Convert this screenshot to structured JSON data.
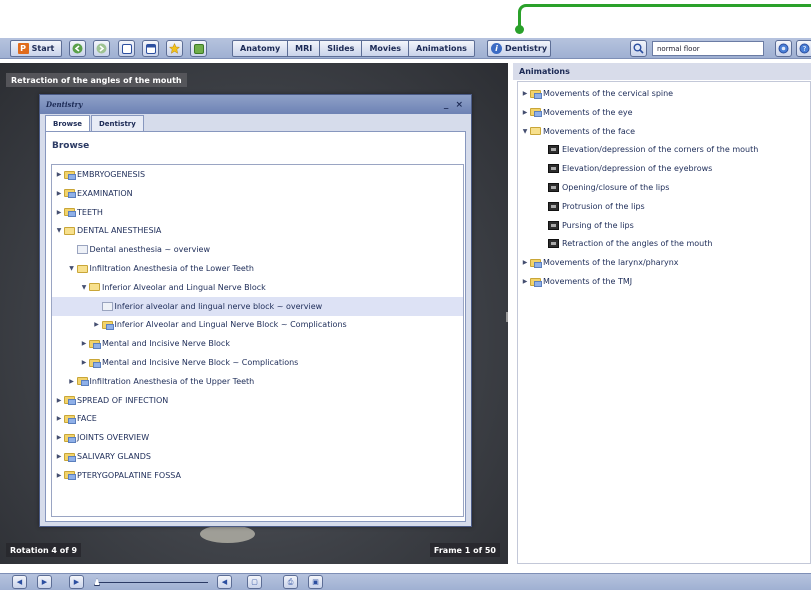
{
  "colors": {
    "accent_green": "#2aa12a",
    "toolbar_bg": "#b6c3de",
    "selection": "#dde2f5"
  },
  "toolbar": {
    "start_label": "Start",
    "tabs": [
      "Anatomy",
      "MRI",
      "Slides",
      "Movies",
      "Animations"
    ],
    "dentistry_label": "Dentistry",
    "search_value": "normal floor",
    "icons": [
      "back-icon",
      "forward-icon",
      "window-icon",
      "layout-icon",
      "favorites-icon",
      "image-icon",
      "search-icon",
      "globe-icon",
      "help-icon"
    ]
  },
  "viewer": {
    "title": "Retraction of the angles of the mouth",
    "rotation": "Rotation 4 of 9",
    "frame": "Frame 1 of 50"
  },
  "dentistry_window": {
    "title": "Dentistry",
    "controls": "_ ×",
    "tabs": [
      "Browse",
      "Dentistry"
    ],
    "heading": "Browse",
    "tree": [
      {
        "label": "EMBRYOGENESIS",
        "level": 0,
        "type": "folder",
        "state": "closed"
      },
      {
        "label": "EXAMINATION",
        "level": 0,
        "type": "folder",
        "state": "closed"
      },
      {
        "label": "TEETH",
        "level": 0,
        "type": "folder",
        "state": "closed"
      },
      {
        "label": "DENTAL ANESTHESIA",
        "level": 0,
        "type": "folder",
        "state": "open"
      },
      {
        "label": "Dental anesthesia ~ overview",
        "level": 1,
        "type": "doc"
      },
      {
        "label": "Infiltration Anesthesia of the Lower Teeth",
        "level": 1,
        "type": "folder",
        "state": "open"
      },
      {
        "label": "Inferior Alveolar and Lingual Nerve Block",
        "level": 2,
        "type": "folder",
        "state": "open"
      },
      {
        "label": "Inferior alveolar and lingual nerve block ~ overview",
        "level": 3,
        "type": "doc",
        "selected": true
      },
      {
        "label": "Inferior Alveolar and Lingual Nerve Block ~ Complications",
        "level": 3,
        "type": "folder",
        "state": "closed"
      },
      {
        "label": "Mental and Incisive Nerve Block",
        "level": 2,
        "type": "folder",
        "state": "closed"
      },
      {
        "label": "Mental and Incisive Nerve Block ~ Complications",
        "level": 2,
        "type": "folder",
        "state": "closed"
      },
      {
        "label": "Infiltration Anesthesia of the Upper Teeth",
        "level": 1,
        "type": "folder",
        "state": "closed"
      },
      {
        "label": "SPREAD OF INFECTION",
        "level": 0,
        "type": "folder",
        "state": "closed"
      },
      {
        "label": "FACE",
        "level": 0,
        "type": "folder",
        "state": "closed"
      },
      {
        "label": "JOINTS OVERVIEW",
        "level": 0,
        "type": "folder",
        "state": "closed"
      },
      {
        "label": "SALIVARY GLANDS",
        "level": 0,
        "type": "folder",
        "state": "closed"
      },
      {
        "label": "PTERYGOPALATINE FOSSA",
        "level": 0,
        "type": "folder",
        "state": "closed"
      }
    ]
  },
  "animations": {
    "header": "Animations",
    "tree": [
      {
        "label": "Movements of the cervical spine",
        "level": 0,
        "type": "folder",
        "state": "closed"
      },
      {
        "label": "Movements of the eye",
        "level": 0,
        "type": "folder",
        "state": "closed"
      },
      {
        "label": "Movements of the face",
        "level": 0,
        "type": "folder",
        "state": "open"
      },
      {
        "label": "Elevation/depression of the corners of the mouth",
        "level": 1,
        "type": "film"
      },
      {
        "label": "Elevation/depression of the eyebrows",
        "level": 1,
        "type": "film"
      },
      {
        "label": "Opening/closure of the lips",
        "level": 1,
        "type": "film"
      },
      {
        "label": "Protrusion of the lips",
        "level": 1,
        "type": "film"
      },
      {
        "label": "Pursing of the lips",
        "level": 1,
        "type": "film"
      },
      {
        "label": "Retraction of the angles of the mouth",
        "level": 1,
        "type": "film"
      },
      {
        "label": "Movements of the larynx/pharynx",
        "level": 0,
        "type": "folder",
        "state": "closed"
      },
      {
        "label": "Movements of the TMJ",
        "level": 0,
        "type": "folder",
        "state": "closed"
      }
    ]
  },
  "bottombar": {
    "icons": [
      "prev-frame-icon",
      "next-frame-icon",
      "play-icon",
      "volume-icon",
      "window-icon",
      "print-icon",
      "save-icon"
    ]
  }
}
